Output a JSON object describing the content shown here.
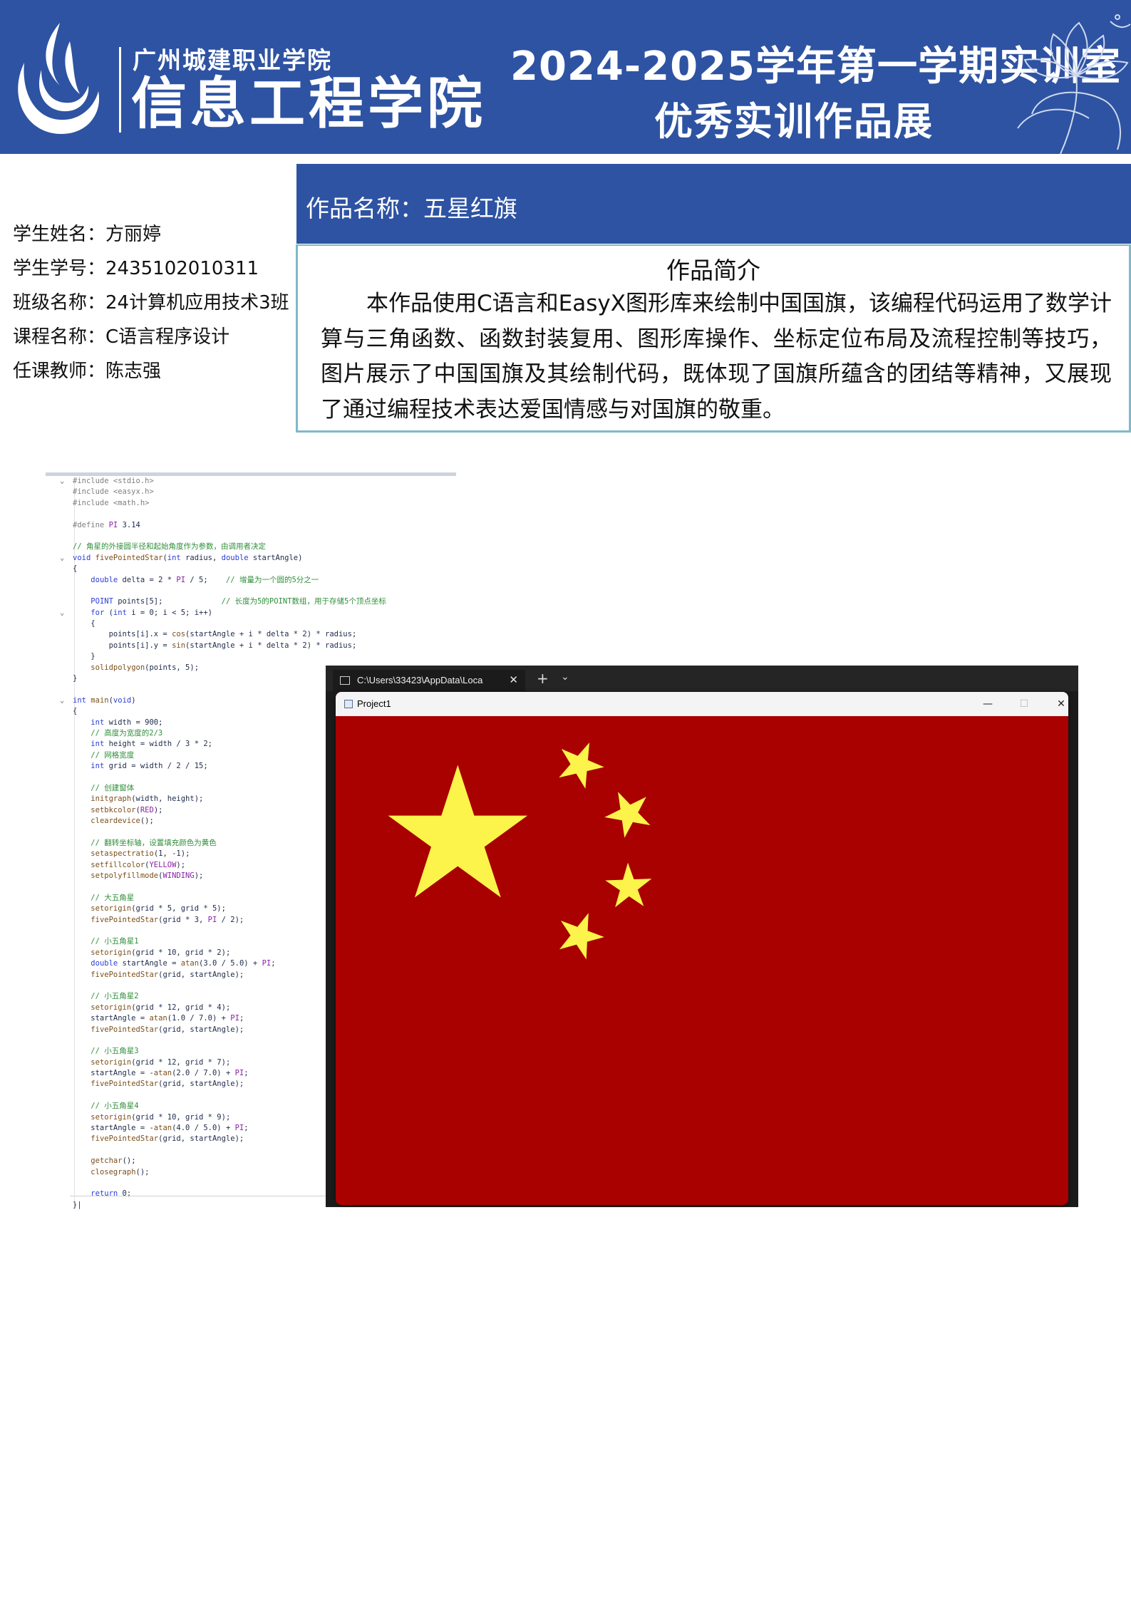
{
  "banner": {
    "school_small": "广州城建职业学院",
    "school_big": "信息工程学院",
    "title_line1": "2024-2025学年第一学期实训室",
    "title_line2": "优秀实训作品展",
    "logo_icon": "college-flame-logo",
    "decoration_icon": "lotus-line-art",
    "color": "#2e53a3"
  },
  "student": {
    "name": "学生姓名：方丽婷",
    "id": "学生学号：2435102010311",
    "class": "班级名称：24计算机应用技术3班",
    "course": "课程名称：C语言程序设计",
    "teacher": "任课教师：陈志强"
  },
  "work": {
    "name": "作品名称：五星红旗",
    "intro_title": "作品简介",
    "intro_text": "本作品使用C语言和EasyX图形库来绘制中国国旗，该编程代码运用了数学计算与三角函数、函数封装复用、图形库操作、坐标定位布局及流程控制等技巧，图片展示了中国国旗及其绘制代码，既体现了国旗所蕴含的团结等精神，又展现了通过编程技术表达爱国情感与对国旗的敬重。"
  },
  "code_lines": [
    {
      "fold": "⌄",
      "html": "<span class='pp'>#include &lt;stdio.h&gt;</span>"
    },
    {
      "fold": "",
      "html": "<span class='pp'>#include &lt;easyx.h&gt;</span>"
    },
    {
      "fold": "",
      "html": "<span class='pp'>#include &lt;math.h&gt;</span>"
    },
    {
      "fold": "",
      "html": ""
    },
    {
      "fold": "",
      "html": "<span class='pp'>#define</span> <span class='mac'>PI</span> 3.14"
    },
    {
      "fold": "",
      "html": ""
    },
    {
      "fold": "",
      "html": "<span class='cm'>// 角星的外接圆半径和起始角度作为参数，由调用者决定</span>"
    },
    {
      "fold": "⌄",
      "html": "<span class='kw'>void</span> <span class='fn'>fivePointedStar</span>(<span class='kw'>int</span> radius, <span class='kw'>double</span> startAngle)"
    },
    {
      "fold": "",
      "html": "{"
    },
    {
      "fold": "",
      "html": "    <span class='kw'>double</span> delta = 2 * <span class='mac'>PI</span> / 5;    <span class='cm'>// 增量为一个圆的5分之一</span>"
    },
    {
      "fold": "",
      "html": ""
    },
    {
      "fold": "",
      "html": "    <span class='kw'>POINT</span> points[5];             <span class='cm'>// 长度为5的POINT数组，用于存储5个顶点坐标</span>"
    },
    {
      "fold": "⌄",
      "html": "    <span class='kw'>for</span> (<span class='kw'>int</span> i = 0; i &lt; 5; i++)"
    },
    {
      "fold": "",
      "html": "    {"
    },
    {
      "fold": "",
      "html": "        points[i].x = <span class='fn'>cos</span>(startAngle + i * delta * 2) * radius;"
    },
    {
      "fold": "",
      "html": "        points[i].y = <span class='fn'>sin</span>(startAngle + i * delta * 2) * radius;"
    },
    {
      "fold": "",
      "html": "    }"
    },
    {
      "fold": "",
      "html": "    <span class='fn'>solidpolygon</span>(points, 5);"
    },
    {
      "fold": "",
      "html": "}"
    },
    {
      "fold": "",
      "html": ""
    },
    {
      "fold": "⌄",
      "html": "<span class='kw'>int</span> <span class='fn'>main</span>(<span class='kw'>void</span>)"
    },
    {
      "fold": "",
      "html": "{"
    },
    {
      "fold": "",
      "html": "    <span class='kw'>int</span> width = 900;"
    },
    {
      "fold": "",
      "html": "    <span class='cm'>// 高度为宽度的2/3</span>"
    },
    {
      "fold": "",
      "html": "    <span class='kw'>int</span> height = width / 3 * 2;"
    },
    {
      "fold": "",
      "html": "    <span class='cm'>// 网格宽度</span>"
    },
    {
      "fold": "",
      "html": "    <span class='kw'>int</span> grid = width / 2 / 15;"
    },
    {
      "fold": "",
      "html": ""
    },
    {
      "fold": "",
      "html": "    <span class='cm'>// 创建窗体</span>"
    },
    {
      "fold": "",
      "html": "    <span class='fn'>initgraph</span>(width, height);"
    },
    {
      "fold": "",
      "html": "    <span class='fn'>setbkcolor</span>(<span class='mac'>RED</span>);"
    },
    {
      "fold": "",
      "html": "    <span class='fn'>cleardevice</span>();"
    },
    {
      "fold": "",
      "html": ""
    },
    {
      "fold": "",
      "html": "    <span class='cm'>// 翻转坐标轴，设置填充颜色为黄色</span>"
    },
    {
      "fold": "",
      "html": "    <span class='fn'>setaspectratio</span>(1, -1);"
    },
    {
      "fold": "",
      "html": "    <span class='fn'>setfillcolor</span>(<span class='mac'>YELLOW</span>);"
    },
    {
      "fold": "",
      "html": "    <span class='fn'>setpolyfillmode</span>(<span class='mac'>WINDING</span>);"
    },
    {
      "fold": "",
      "html": ""
    },
    {
      "fold": "",
      "html": "    <span class='cm'>// 大五角星</span>"
    },
    {
      "fold": "",
      "html": "    <span class='fn'>setorigin</span>(grid * 5, grid * 5);"
    },
    {
      "fold": "",
      "html": "    <span class='fn'>fivePointedStar</span>(grid * 3, <span class='mac'>PI</span> / 2);"
    },
    {
      "fold": "",
      "html": ""
    },
    {
      "fold": "",
      "html": "    <span class='cm'>// 小五角星1</span>"
    },
    {
      "fold": "",
      "html": "    <span class='fn'>setorigin</span>(grid * 10, grid * 2);"
    },
    {
      "fold": "",
      "html": "    <span class='kw'>double</span> startAngle = <span class='fn'>atan</span>(3.0 / 5.0) + <span class='mac'>PI</span>;"
    },
    {
      "fold": "",
      "html": "    <span class='fn'>fivePointedStar</span>(grid, startAngle);"
    },
    {
      "fold": "",
      "html": ""
    },
    {
      "fold": "",
      "html": "    <span class='cm'>// 小五角星2</span>"
    },
    {
      "fold": "",
      "html": "    <span class='fn'>setorigin</span>(grid * 12, grid * 4);"
    },
    {
      "fold": "",
      "html": "    startAngle = <span class='fn'>atan</span>(1.0 / 7.0) + <span class='mac'>PI</span>;"
    },
    {
      "fold": "",
      "html": "    <span class='fn'>fivePointedStar</span>(grid, startAngle);"
    },
    {
      "fold": "",
      "html": ""
    },
    {
      "fold": "",
      "html": "    <span class='cm'>// 小五角星3</span>"
    },
    {
      "fold": "",
      "html": "    <span class='fn'>setorigin</span>(grid * 12, grid * 7);"
    },
    {
      "fold": "",
      "html": "    startAngle = -<span class='fn'>atan</span>(2.0 / 7.0) + <span class='mac'>PI</span>;"
    },
    {
      "fold": "",
      "html": "    <span class='fn'>fivePointedStar</span>(grid, startAngle);"
    },
    {
      "fold": "",
      "html": ""
    },
    {
      "fold": "",
      "html": "    <span class='cm'>// 小五角星4</span>"
    },
    {
      "fold": "",
      "html": "    <span class='fn'>setorigin</span>(grid * 10, grid * 9);"
    },
    {
      "fold": "",
      "html": "    startAngle = -<span class='fn'>atan</span>(4.0 / 5.0) + <span class='mac'>PI</span>;"
    },
    {
      "fold": "",
      "html": "    <span class='fn'>fivePointedStar</span>(grid, startAngle);"
    },
    {
      "fold": "",
      "html": ""
    },
    {
      "fold": "",
      "html": "    <span class='fn'>getchar</span>();"
    },
    {
      "fold": "",
      "html": "    <span class='fn'>closegraph</span>();"
    },
    {
      "fold": "",
      "html": ""
    },
    {
      "fold": "",
      "html": "    <span class='kw'>return</span> 0;"
    },
    {
      "fold": "",
      "html": "}|"
    }
  ],
  "terminal": {
    "tab_title": "C:\\Users\\33423\\AppData\\Loca",
    "close_glyph": "✕",
    "plus_glyph": "+",
    "dropdown_glyph": "⌄",
    "tab_icon": "terminal-icon"
  },
  "window": {
    "title": "Project1",
    "minimize_glyph": "—",
    "maximize_glyph": "☐",
    "close_glyph": "✕",
    "app_icon": "app-window-icon"
  },
  "flag": {
    "background": "#a90000",
    "star_color": "#fcf44a"
  }
}
